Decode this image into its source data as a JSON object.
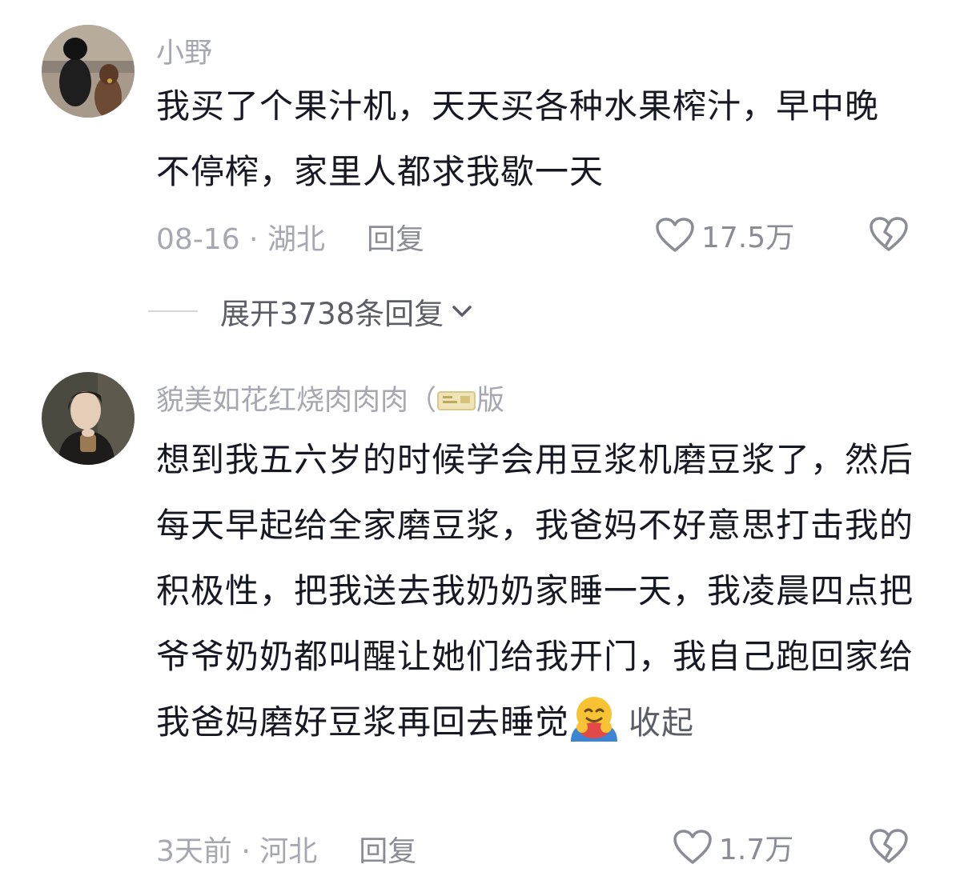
{
  "comments": [
    {
      "username": "小野",
      "text": "我买了个果汁机，天天买各种水果榨汁，早中晚不停榨，家里人都求我歇一天",
      "date_location": "08-16 · 湖北",
      "reply_label": "回复",
      "likes": "17.5万"
    },
    {
      "username": "貌美如花红烧肉肉肉（",
      "username_suffix": "版",
      "text": "想到我五六岁的时候学会用豆浆机磨豆浆了，然后每天早起给全家磨豆浆，我爸妈不好意思打击我的积极性，把我送去我奶奶家睡一天，我凌晨四点把爷爷奶奶都叫醒让她们给我开门，我自己跑回家给我爸妈磨好豆浆再回去睡觉",
      "collapse_label": "收起",
      "date_location": "3天前 · 河北",
      "reply_label": "回复",
      "likes": "1.7万"
    }
  ],
  "expand_replies": "展开3738条回复",
  "icons": {
    "like": "heart-outline-icon",
    "dislike": "broken-heart-icon",
    "expand": "chevron-down-icon",
    "badge": "ticket-badge-icon",
    "emoji": "hugging-face-emoji"
  }
}
